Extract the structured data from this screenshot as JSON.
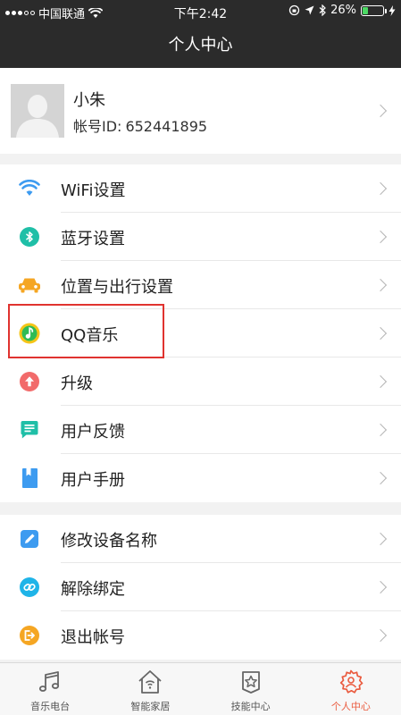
{
  "status_bar": {
    "carrier": "中国联通",
    "time": "下午2:42",
    "battery": "26%",
    "battery_level": 0.26
  },
  "header": {
    "title": "个人中心"
  },
  "profile": {
    "name": "小朱",
    "account_label": "帐号ID:",
    "account_id": "652441895"
  },
  "menu_group_1": [
    {
      "label": "WiFi设置",
      "icon": "wifi-icon",
      "color": "#3d9bf0"
    },
    {
      "label": "蓝牙设置",
      "icon": "bluetooth-icon",
      "color": "#1fbfa7"
    },
    {
      "label": "位置与出行设置",
      "icon": "car-icon",
      "color": "#f5a623"
    },
    {
      "label": "QQ音乐",
      "icon": "qq-music-icon",
      "color": "#f5c518"
    },
    {
      "label": "升级",
      "icon": "upgrade-icon",
      "color": "#f26b6b"
    },
    {
      "label": "用户反馈",
      "icon": "feedback-icon",
      "color": "#1fbfa7"
    },
    {
      "label": "用户手册",
      "icon": "manual-icon",
      "color": "#3d9bf0"
    }
  ],
  "menu_group_2": [
    {
      "label": "修改设备名称",
      "icon": "edit-icon",
      "color": "#3d9bf0"
    },
    {
      "label": "解除绑定",
      "icon": "unlink-icon",
      "color": "#1fb4e8"
    },
    {
      "label": "退出帐号",
      "icon": "logout-icon",
      "color": "#f5a623"
    }
  ],
  "tabs": [
    {
      "label": "音乐电台",
      "icon": "music-note-icon"
    },
    {
      "label": "智能家居",
      "icon": "smart-home-icon"
    },
    {
      "label": "技能中心",
      "icon": "skill-star-icon"
    },
    {
      "label": "个人中心",
      "icon": "personal-gear-icon",
      "active": true
    }
  ],
  "colors": {
    "accent": "#ea5b3f",
    "header_bg": "#2b2b2b",
    "highlight": "#e0332f"
  }
}
